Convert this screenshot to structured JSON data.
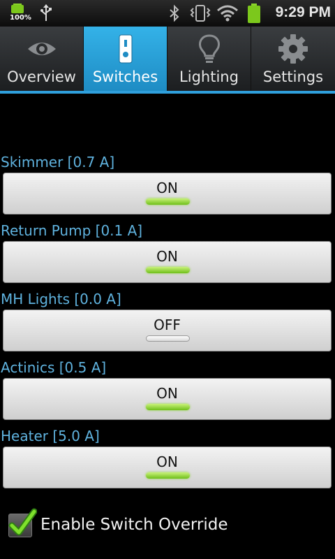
{
  "status_bar": {
    "battery_small_percent": "100%",
    "time": "9:29 PM"
  },
  "tabs": [
    {
      "label": "Overview",
      "icon": "eye-icon",
      "active": false
    },
    {
      "label": "Switches",
      "icon": "switch-icon",
      "active": true
    },
    {
      "label": "Lighting",
      "icon": "lightbulb-icon",
      "active": false
    },
    {
      "label": "Settings",
      "icon": "gear-icon",
      "active": false
    }
  ],
  "switches": [
    {
      "label": "Skimmer [0.7 A]",
      "state": "ON"
    },
    {
      "label": "Return Pump [0.1 A]",
      "state": "ON"
    },
    {
      "label": "MH Lights [0.0 A]",
      "state": "OFF"
    },
    {
      "label": "Actinics [0.5 A]",
      "state": "ON"
    },
    {
      "label": "Heater [5.0 A]",
      "state": "ON"
    }
  ],
  "override": {
    "label": "Enable Switch Override",
    "checked": true
  },
  "colors": {
    "accent": "#2f9fdc",
    "label_blue": "#5fb2de",
    "on_indicator": "#6fbf1a"
  }
}
